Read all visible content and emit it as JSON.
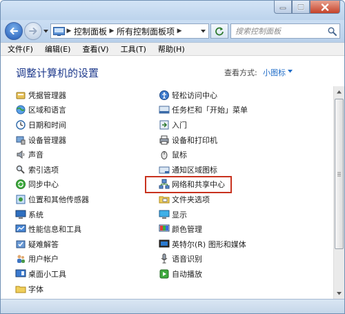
{
  "window": {
    "caption_buttons": [
      "minimize-icon",
      "maximize-icon",
      "close-icon"
    ]
  },
  "address_bar": {
    "breadcrumbs": [
      "控制面板",
      "所有控制面板项"
    ],
    "search_placeholder": "搜索控制面板"
  },
  "menu": {
    "items": [
      "文件(F)",
      "编辑(E)",
      "查看(V)",
      "工具(T)",
      "帮助(H)"
    ]
  },
  "content": {
    "title": "调整计算机的设置",
    "view_label": "查看方式:",
    "view_value": "小图标",
    "left_items": [
      {
        "label": "凭据管理器",
        "icon": "credential-icon"
      },
      {
        "label": "区域和语言",
        "icon": "globe-icon"
      },
      {
        "label": "日期和时间",
        "icon": "clock-icon"
      },
      {
        "label": "设备管理器",
        "icon": "device-manager-icon"
      },
      {
        "label": "声音",
        "icon": "speaker-icon"
      },
      {
        "label": "索引选项",
        "icon": "index-icon"
      },
      {
        "label": "同步中心",
        "icon": "sync-icon"
      },
      {
        "label": "位置和其他传感器",
        "icon": "sensor-icon"
      },
      {
        "label": "系统",
        "icon": "system-icon"
      },
      {
        "label": "性能信息和工具",
        "icon": "performance-icon"
      },
      {
        "label": "疑难解答",
        "icon": "troubleshoot-icon"
      },
      {
        "label": "用户帐户",
        "icon": "users-icon"
      },
      {
        "label": "桌面小工具",
        "icon": "gadgets-icon"
      },
      {
        "label": "字体",
        "icon": "folder-icon"
      }
    ],
    "right_items": [
      {
        "label": "轻松访问中心",
        "icon": "accessibility-icon"
      },
      {
        "label": "任务栏和「开始」菜单",
        "icon": "taskbar-icon"
      },
      {
        "label": "入门",
        "icon": "getting-started-icon"
      },
      {
        "label": "设备和打印机",
        "icon": "printer-icon"
      },
      {
        "label": "鼠标",
        "icon": "mouse-icon"
      },
      {
        "label": "通知区域图标",
        "icon": "notification-icon"
      },
      {
        "label": "网络和共享中心",
        "icon": "network-icon"
      },
      {
        "label": "文件夹选项",
        "icon": "folder-options-icon"
      },
      {
        "label": "显示",
        "icon": "display-icon"
      },
      {
        "label": "颜色管理",
        "icon": "color-icon"
      },
      {
        "label": "英特尔(R) 图形和媒体",
        "icon": "intel-graphics-icon"
      },
      {
        "label": "语音识别",
        "icon": "microphone-icon"
      },
      {
        "label": "自动播放",
        "icon": "autoplay-icon"
      }
    ],
    "highlighted_item": "网络和共享中心",
    "highlight_color": "#c8321e"
  },
  "colors": {
    "title": "#1e3a8c",
    "link": "#1f6cc8"
  }
}
